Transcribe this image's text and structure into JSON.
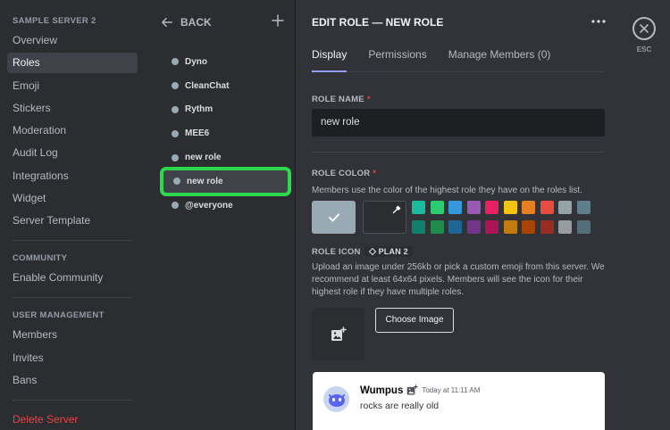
{
  "sidebar": {
    "server_header": "SAMPLE SERVER 2",
    "server_items": [
      "Overview",
      "Roles",
      "Emoji",
      "Stickers",
      "Moderation",
      "Audit Log",
      "Integrations",
      "Widget",
      "Server Template"
    ],
    "community_header": "COMMUNITY",
    "community_items": [
      "Enable Community"
    ],
    "user_mgmt_header": "USER MANAGEMENT",
    "user_mgmt_items": [
      "Members",
      "Invites",
      "Bans"
    ],
    "delete_label": "Delete Server",
    "active_item": "Roles"
  },
  "roles_panel": {
    "back_label": "BACK",
    "roles": [
      "Dyno",
      "CleanChat",
      "Rythm",
      "MEE6",
      "new role",
      "new role",
      "@everyone"
    ],
    "selected_index": 5
  },
  "edit": {
    "title": "EDIT ROLE — NEW ROLE",
    "tabs": [
      "Display",
      "Permissions",
      "Manage Members (0)"
    ],
    "active_tab": "Display",
    "role_name_label": "ROLE NAME",
    "required_mark": "*",
    "role_name_value": "new role",
    "role_color_label": "ROLE COLOR",
    "role_color_desc": "Members use the color of the highest role they have on the roles list.",
    "default_color": "#99aab5",
    "color_row_1": [
      "#1abc9c",
      "#2ecc71",
      "#3498db",
      "#9b59b6",
      "#e91e63",
      "#f1c40f",
      "#e67e22",
      "#e74c3c",
      "#95a5a6",
      "#607d8b"
    ],
    "color_row_2": [
      "#11806a",
      "#1f8b4c",
      "#206694",
      "#71368a",
      "#ad1457",
      "#c27c0e",
      "#a84300",
      "#992d22",
      "#979c9f",
      "#546e7a"
    ],
    "role_icon_label": "ROLE ICON",
    "plan_badge": "PLAN 2",
    "role_icon_desc": "Upload an image under 256kb or pick a custom emoji from this server. We recommend at least 64x64 pixels. Members will see the icon for their highest role if they have multiple roles.",
    "choose_image": "Choose Image"
  },
  "preview": {
    "username": "Wumpus",
    "timestamp": "Today at 11:11 AM",
    "message": "rocks are really old"
  },
  "close": {
    "label": "ESC"
  },
  "icons": {
    "back": "arrow-left-icon",
    "add": "plus-icon",
    "more": "ellipsis-icon",
    "picker": "eyedropper-icon",
    "check": "check-icon",
    "upload": "image-add-icon",
    "close": "close-icon"
  }
}
